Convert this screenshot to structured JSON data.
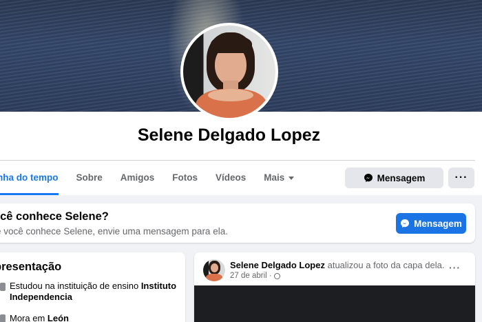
{
  "profile": {
    "name": "Selene Delgado Lopez"
  },
  "tabs": [
    {
      "label": "nha do tempo"
    },
    {
      "label": "Sobre"
    },
    {
      "label": "Amigos"
    },
    {
      "label": "Fotos"
    },
    {
      "label": "Vídeos"
    },
    {
      "label": "Mais"
    }
  ],
  "actions": {
    "message_label": "Mensagem",
    "more_label": "···"
  },
  "know_card": {
    "title": "ocê conhece Selene?",
    "subtitle": "e você conhece Selene, envie uma mensagem para ela.",
    "button_label": "Mensagem"
  },
  "intro": {
    "title": "presentação",
    "education_prefix": "Estudou na instituição de ensino ",
    "education_place": "Instituto Independencia",
    "location_prefix": "Mora em ",
    "location_place": "León"
  },
  "post": {
    "author": "Selene Delgado Lopez",
    "action": " atualizou a foto da capa dela.",
    "date": "27 de abril ·",
    "menu_label": "···"
  },
  "colors": {
    "accent": "#1877f2",
    "button_blue": "#1b74e4",
    "button_gray": "#e4e6eb",
    "background": "#f0f2f5"
  },
  "icons": [
    "messenger-icon",
    "globe-icon",
    "school-icon",
    "home-icon",
    "caret-down-icon"
  ]
}
